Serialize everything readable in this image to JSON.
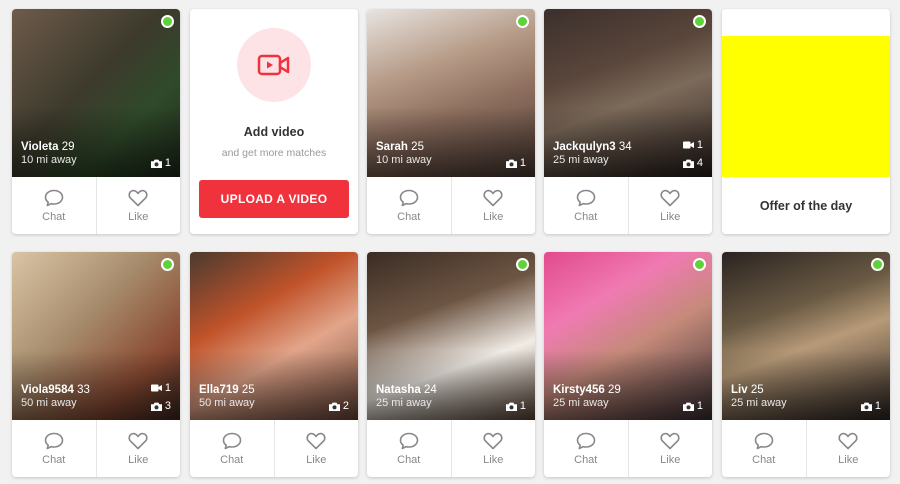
{
  "profiles": [
    {
      "name": "Violeta",
      "age": "29",
      "distance": "10 mi away",
      "photos": "1",
      "videos": "",
      "online": true,
      "tint": "linear-gradient(135deg,#6e5b4b 0%,#3d3a2c 45%,#2f4a2a 70%,#1e2a1a 100%)"
    },
    {
      "name": "Sarah",
      "age": "25",
      "distance": "10 mi away",
      "photos": "1",
      "videos": "",
      "online": true,
      "tint": "linear-gradient(160deg,#e8e4e0 0%,#b59a86 35%,#8d6e5e 60%,#4a3a33 100%)"
    },
    {
      "name": "Jackqulyn3",
      "age": "34",
      "distance": "25 mi away",
      "photos": "4",
      "videos": "1",
      "online": true,
      "tint": "linear-gradient(160deg,#3b2f2c 0%,#5a463b 35%,#7c6a5a 55%,#2a201d 100%)"
    },
    {
      "name": "Viola9584",
      "age": "33",
      "distance": "50 mi away",
      "photos": "3",
      "videos": "1",
      "online": true,
      "tint": "linear-gradient(135deg,#d9c4a5 0%,#a88e6e 40%,#8a4a32 75%,#3d2820 100%)"
    },
    {
      "name": "Ella719",
      "age": "25",
      "distance": "50 mi away",
      "photos": "2",
      "videos": "",
      "online": false,
      "tint": "linear-gradient(150deg,#4a3a30 0%,#c0532a 35%,#e2a58a 60%,#6b4638 100%)"
    },
    {
      "name": "Natasha",
      "age": "24",
      "distance": "25 mi away",
      "photos": "1",
      "videos": "",
      "online": true,
      "tint": "linear-gradient(160deg,#3a2c24 0%,#6d5543 35%,#f1ece6 65%,#5a4637 100%)"
    },
    {
      "name": "Kirsty456",
      "age": "29",
      "distance": "25 mi away",
      "photos": "1",
      "videos": "",
      "online": true,
      "tint": "linear-gradient(150deg,#e24a8e 0%,#f07ab2 30%,#c58a7a 55%,#3a3034 100%)"
    },
    {
      "name": "Liv",
      "age": "25",
      "distance": "25 mi away",
      "photos": "1",
      "videos": "",
      "online": true,
      "tint": "linear-gradient(160deg,#2a2320 0%,#6a5a44 35%,#b79a78 55%,#2d2522 100%)"
    }
  ],
  "actions": {
    "chat": "Chat",
    "like": "Like"
  },
  "video_promo": {
    "title": "Add video",
    "subtitle": "and get more matches",
    "button": "UPLOAD A VIDEO"
  },
  "offer": {
    "label": "Offer of the day",
    "color": "#ffff00"
  },
  "colors": {
    "accent": "#f0323c",
    "online": "#5fd13a",
    "accent_soft": "#fde3e5"
  }
}
